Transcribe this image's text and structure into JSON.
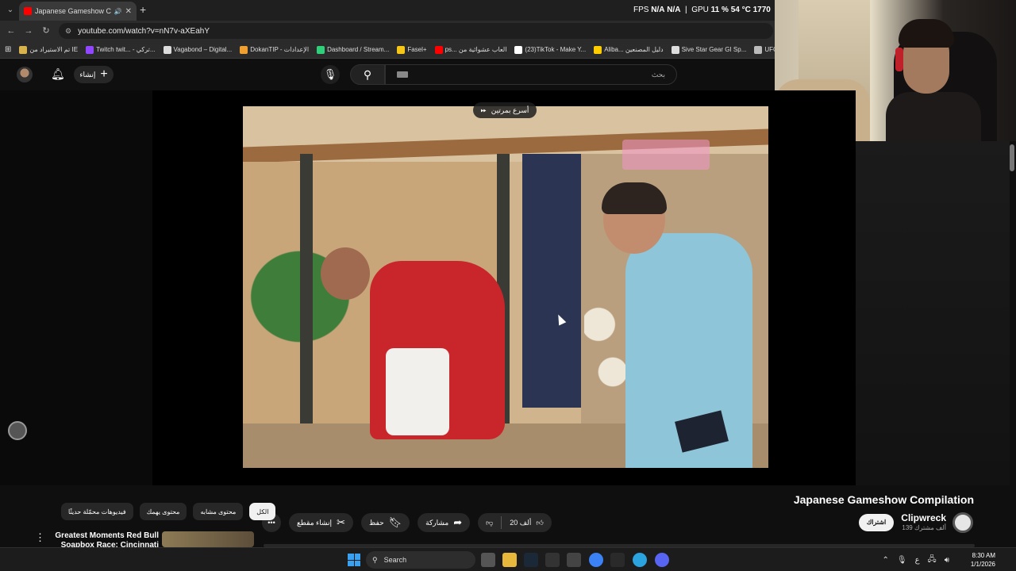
{
  "browser": {
    "tab_title": "Japanese Gameshow Comp",
    "address": "youtube.com/watch?v=nN7v-aXEahY",
    "bookmarks": [
      {
        "label": "تم الاستيراد من IE",
        "color": "#d8b24a"
      },
      {
        "label": "Twitch twit... - تركي...",
        "color": "#9146ff"
      },
      {
        "label": "Vagabond – Digital...",
        "color": "#dddddd"
      },
      {
        "label": "DokanTIP - الإعدادات",
        "color": "#f0a030"
      },
      {
        "label": "Dashboard / Stream...",
        "color": "#2fd07a"
      },
      {
        "label": "Fasel+",
        "color": "#f5c518"
      },
      {
        "label": "ps... العاب عشوائية من",
        "color": "#ff0000"
      },
      {
        "label": "(23)TikTok - Make Y...",
        "color": "#ffffff"
      },
      {
        "label": "Aliba... دليل المصنعين",
        "color": "#ffcc00"
      },
      {
        "label": "Sive Star Gear GI Sp...",
        "color": "#dddddd"
      },
      {
        "label": "UFC Fight",
        "color": "#bbbbbb"
      }
    ]
  },
  "overlay": {
    "fps_label": "FPS",
    "fps_value": "N/A",
    "fps_value2": "N/A",
    "gpu_label": "GPU",
    "gpu_load": "11 %",
    "gpu_temp": "54 °C",
    "gpu_clock": "1770"
  },
  "header": {
    "create_label": "إنشاء",
    "search_placeholder": "بحث"
  },
  "player": {
    "speed_label": "أسرع بمرتين"
  },
  "video": {
    "title": "Japanese Gameshow Compilation",
    "channel": "Clipwreck",
    "subscribers": "139 ألف مشترك",
    "subscribe_label": "اشتراك",
    "likes": "20 ألف",
    "share_label": "مشاركة",
    "save_label": "حفظ",
    "clip_label": "إنشاء مقطع"
  },
  "chips": [
    {
      "label": "الكل",
      "active": true
    },
    {
      "label": "محتوى مشابه",
      "active": false
    },
    {
      "label": "محتوى يهمك",
      "active": false
    },
    {
      "label": "فيديوهات محمّلة حديثًا",
      "active": false
    }
  ],
  "recommendation": {
    "title": "Greatest Moments Red Bull Soapbox Race: Cincinnati"
  },
  "taskbar": {
    "search_label": "Search",
    "lang": "ع",
    "time": "8:30 AM",
    "date": "1/1/2026"
  }
}
